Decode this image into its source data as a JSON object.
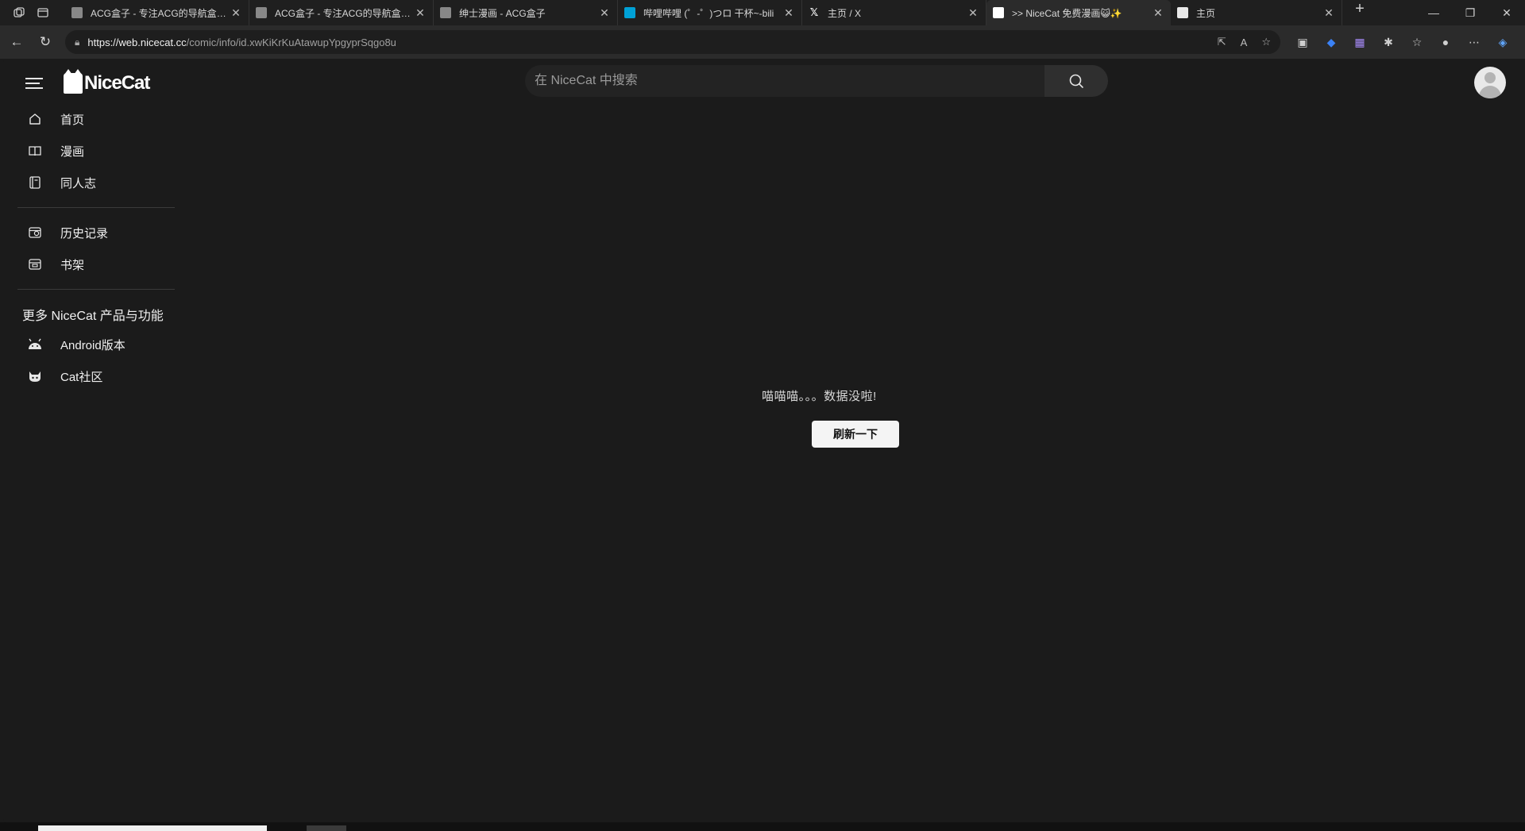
{
  "browser": {
    "tabs": [
      {
        "title": "ACG盒子 - 专注ACG的导航盒子_",
        "active": false
      },
      {
        "title": "ACG盒子 - 专注ACG的导航盒子_",
        "active": false
      },
      {
        "title": "绅士漫画 - ACG盒子",
        "active": false
      },
      {
        "title": "哔哩哔哩 (゜-゜)つロ 干杯~-bili",
        "active": false
      },
      {
        "title": "主页 / X",
        "active": false
      },
      {
        "title": ">> NiceCat 免费漫画😺✨",
        "active": true
      },
      {
        "title": "主页",
        "active": false
      }
    ],
    "url_host": "https://web.nicecat.cc",
    "url_path": "/comic/info/id.xwKiKrKuAtawupYpgyprSqgo8u"
  },
  "header": {
    "logo_text": "NiceCat",
    "search_placeholder": "在 NiceCat 中搜索"
  },
  "sidebar": {
    "main_items": [
      {
        "label": "首页",
        "icon": "home-icon"
      },
      {
        "label": "漫画",
        "icon": "book-icon"
      },
      {
        "label": "同人志",
        "icon": "notebook-icon"
      }
    ],
    "library_items": [
      {
        "label": "历史记录",
        "icon": "history-icon"
      },
      {
        "label": "书架",
        "icon": "bookshelf-icon"
      }
    ],
    "more_title": "更多 NiceCat 产品与功能",
    "more_items": [
      {
        "label": "Android版本",
        "icon": "android-icon"
      },
      {
        "label": "Cat社区",
        "icon": "cat-icon"
      }
    ]
  },
  "main": {
    "empty_message": "喵喵喵。。。数据没啦!",
    "refresh_label": "刷新一下"
  },
  "colors": {
    "background": "#1b1b1b",
    "chrome": "#2b2b2b",
    "button": "#f4f4f4"
  }
}
